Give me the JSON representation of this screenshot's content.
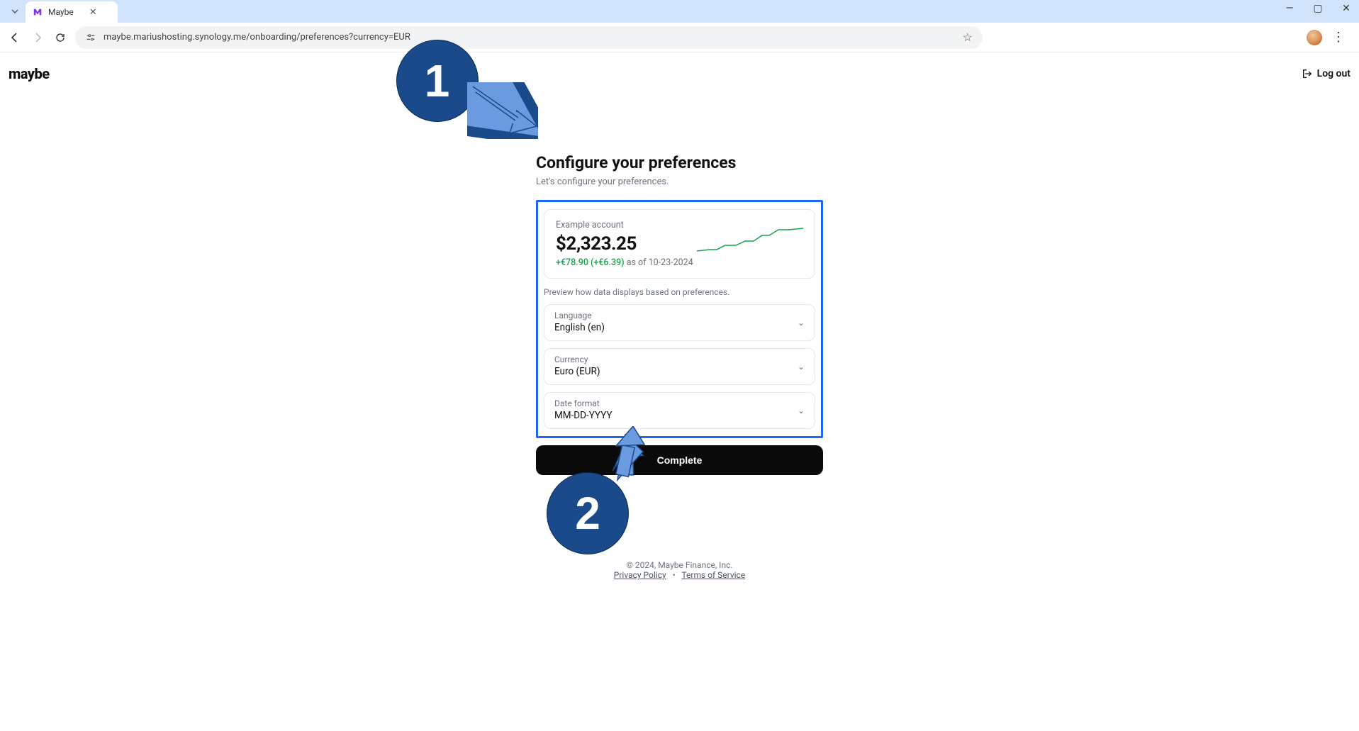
{
  "browser": {
    "tab_title": "Maybe",
    "url": "maybe.mariushosting.synology.me/onboarding/preferences?currency=EUR"
  },
  "header": {
    "logo": "maybe",
    "logout": "Log out"
  },
  "main": {
    "title": "Configure your preferences",
    "subtitle": "Let's configure your preferences.",
    "preview": {
      "account_label": "Example account",
      "amount": "$2,323.25",
      "delta_gain": "+€78.90 (+€6.39)",
      "delta_asof": "as of 10-23-2024"
    },
    "preview_note": "Preview how data displays based on preferences.",
    "fields": {
      "language": {
        "label": "Language",
        "value": "English (en)"
      },
      "currency": {
        "label": "Currency",
        "value": "Euro (EUR)"
      },
      "date_format": {
        "label": "Date format",
        "value": "MM-DD-YYYY"
      }
    },
    "complete_button": "Complete"
  },
  "footer": {
    "copyright": "© 2024, Maybe Finance, Inc.",
    "privacy": "Privacy Policy",
    "terms": "Terms of Service"
  },
  "annotations": {
    "callout_1": "1",
    "callout_2": "2"
  }
}
